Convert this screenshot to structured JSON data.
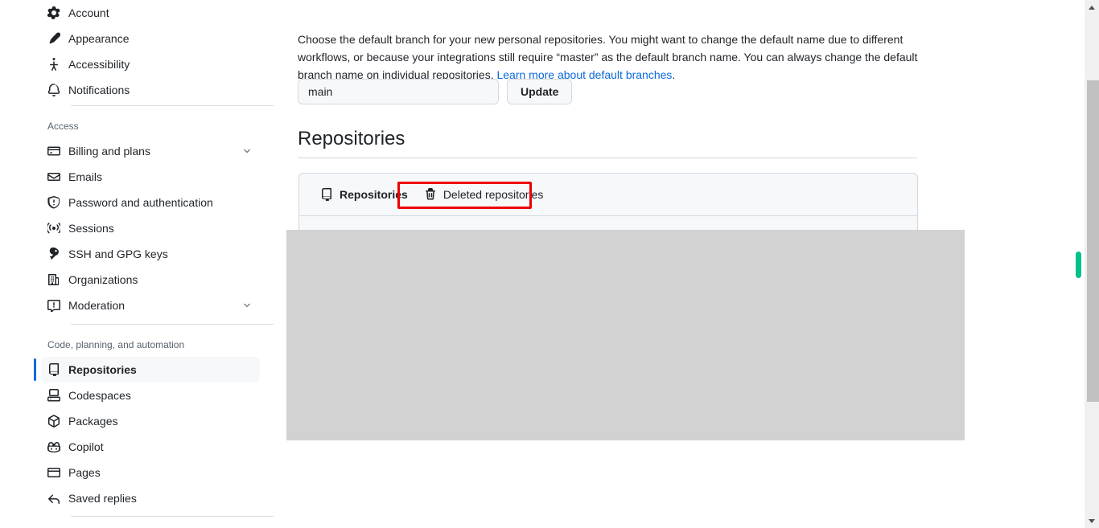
{
  "sidebar": {
    "groups": [
      {
        "heading": null,
        "items": [
          {
            "label": "Account",
            "icon": "gear-icon",
            "name": "account",
            "chevron": false,
            "active": false
          },
          {
            "label": "Appearance",
            "icon": "paintbrush-icon",
            "name": "appearance",
            "chevron": false,
            "active": false
          },
          {
            "label": "Accessibility",
            "icon": "accessibility-icon",
            "name": "accessibility",
            "chevron": false,
            "active": false
          },
          {
            "label": "Notifications",
            "icon": "bell-icon",
            "name": "notifications",
            "chevron": false,
            "active": false
          }
        ]
      },
      {
        "heading": "Access",
        "items": [
          {
            "label": "Billing and plans",
            "icon": "credit-card-icon",
            "name": "billing-and-plans",
            "chevron": true,
            "active": false
          },
          {
            "label": "Emails",
            "icon": "mail-icon",
            "name": "emails",
            "chevron": false,
            "active": false
          },
          {
            "label": "Password and authentication",
            "icon": "shield-lock-icon",
            "name": "password-and-authentication",
            "chevron": false,
            "active": false
          },
          {
            "label": "Sessions",
            "icon": "broadcast-icon",
            "name": "sessions",
            "chevron": false,
            "active": false
          },
          {
            "label": "SSH and GPG keys",
            "icon": "key-icon",
            "name": "ssh-and-gpg-keys",
            "chevron": false,
            "active": false
          },
          {
            "label": "Organizations",
            "icon": "organization-icon",
            "name": "organizations",
            "chevron": false,
            "active": false
          },
          {
            "label": "Moderation",
            "icon": "report-icon",
            "name": "moderation",
            "chevron": true,
            "active": false
          }
        ]
      },
      {
        "heading": "Code, planning, and automation",
        "items": [
          {
            "label": "Repositories",
            "icon": "repo-icon",
            "name": "repositories",
            "chevron": false,
            "active": true
          },
          {
            "label": "Codespaces",
            "icon": "codespaces-icon",
            "name": "codespaces",
            "chevron": false,
            "active": false
          },
          {
            "label": "Packages",
            "icon": "package-icon",
            "name": "packages",
            "chevron": false,
            "active": false
          },
          {
            "label": "Copilot",
            "icon": "copilot-icon",
            "name": "copilot",
            "chevron": false,
            "active": false
          },
          {
            "label": "Pages",
            "icon": "browser-icon",
            "name": "pages",
            "chevron": false,
            "active": false
          },
          {
            "label": "Saved replies",
            "icon": "reply-icon",
            "name": "saved-replies",
            "chevron": false,
            "active": false
          }
        ]
      }
    ]
  },
  "main": {
    "default_branch": {
      "description_part1": "Choose the default branch for your new personal repositories. You might want to change the default name due to different workflows, or because your integrations still require “master” as the default branch name. You can always change the default branch name on individual repositories. ",
      "link_text": "Learn more about default branches",
      "description_part2": ".",
      "input_value": "main",
      "input_placeholder": "main",
      "update_label": "Update"
    },
    "repositories_heading": "Repositories",
    "card_tabs": [
      {
        "label": "Repositories",
        "icon": "repo-icon",
        "name": "tab-repositories",
        "selected": true
      },
      {
        "label": "Deleted repositories",
        "icon": "trash-icon",
        "name": "tab-deleted-repositories",
        "selected": false
      }
    ]
  },
  "annotation": {
    "highlight_color": "#ee0000",
    "target": "Deleted repositories"
  },
  "scrollbars": {
    "inner_marker_color": "#00c08b",
    "outer_thumb_color": "#c1c1c1",
    "outer_track_color": "#f0f0f0"
  }
}
